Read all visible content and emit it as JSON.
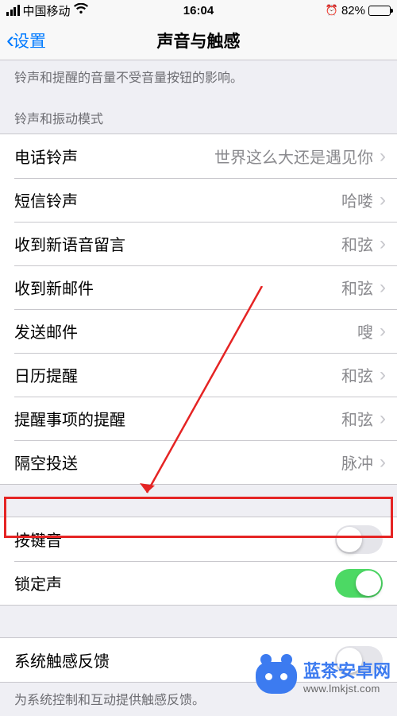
{
  "status_bar": {
    "carrier": "中国移动",
    "time": "16:04",
    "battery_percent": "82%"
  },
  "nav": {
    "back_label": "设置",
    "title": "声音与触感"
  },
  "footer_volume": "铃声和提醒的音量不受音量按钮的影响。",
  "header_ringtone": "铃声和振动模式",
  "sounds": [
    {
      "label": "电话铃声",
      "detail": "世界这么大还是遇见你"
    },
    {
      "label": "短信铃声",
      "detail": "哈喽"
    },
    {
      "label": "收到新语音留言",
      "detail": "和弦"
    },
    {
      "label": "收到新邮件",
      "detail": "和弦"
    },
    {
      "label": "发送邮件",
      "detail": "嗖"
    },
    {
      "label": "日历提醒",
      "detail": "和弦"
    },
    {
      "label": "提醒事项的提醒",
      "detail": "和弦"
    },
    {
      "label": "隔空投送",
      "detail": "脉冲"
    }
  ],
  "toggles_group1": [
    {
      "label": "按键音",
      "on": false
    },
    {
      "label": "锁定声",
      "on": true
    }
  ],
  "toggles_group2": [
    {
      "label": "系统触感反馈",
      "on": false
    }
  ],
  "footer_haptics": "为系统控制和互动提供触感反馈。",
  "watermark": {
    "title": "蓝茶安卓网",
    "url": "www.lmkjst.com"
  }
}
